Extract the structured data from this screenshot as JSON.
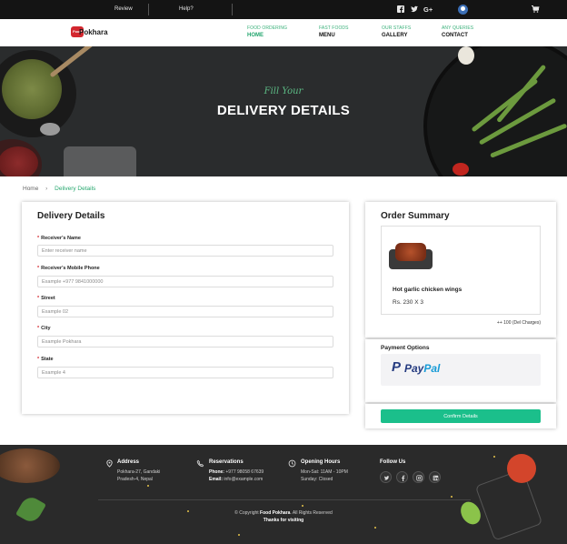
{
  "topbar": {
    "review": "Review",
    "help": "Help?",
    "icons": [
      "facebook-icon",
      "twitter-icon",
      "google-plus-icon",
      "user-icon",
      "cart-icon"
    ],
    "background": "#141414"
  },
  "brand": {
    "badge": "Food",
    "name": "Pokhara",
    "color": "#d3272f"
  },
  "nav": [
    {
      "top": "FOOD ORDERING",
      "bottom": "HOME",
      "active": true
    },
    {
      "top": "FAST FOODS",
      "bottom": "MENU",
      "active": false
    },
    {
      "top": "OUR STAFFS",
      "bottom": "GALLERY",
      "active": false
    },
    {
      "top": "ANY QUERIES",
      "bottom": "CONTACT",
      "active": false
    }
  ],
  "hero": {
    "kicker": "Fill Your",
    "title": "DELIVERY DETAILS"
  },
  "breadcrumb": {
    "home": "Home",
    "current": "Delivery Details"
  },
  "form": {
    "title": "Delivery Details",
    "fields": [
      {
        "label": "Receiver's Name",
        "placeholder": "Enter receiver name"
      },
      {
        "label": "Receiver's Mobile Phone",
        "placeholder": "Example +977 9841000000"
      },
      {
        "label": "Street",
        "placeholder": "Example 02"
      },
      {
        "label": "City",
        "placeholder": "Example Pokhara"
      },
      {
        "label": "State",
        "placeholder": "Example 4"
      }
    ]
  },
  "summary": {
    "title": "Order Summary",
    "item_name": "Hot garlic chicken wings",
    "item_price": "Rs. 230 X 3",
    "del_charges": "++ 100 (Del Charges)"
  },
  "payment": {
    "title": "Payment Options",
    "provider": "PayPal"
  },
  "confirm": {
    "label": "Confirm Details",
    "color": "#1bbf8b"
  },
  "footer": {
    "address_head": "Address",
    "address_1": "Pokhara-27, Gandaki",
    "address_2": "Pradesh-4, Nepal",
    "reservations_head": "Reservations",
    "phone_label": "Phone:",
    "phone": "+977 98058 67639",
    "email_label": "Email:",
    "email": "info@example.com",
    "hours_head": "Opening Hours",
    "hours_1": "Mon-Sat: 11AM - 10PM",
    "hours_2": "Sunday: Closed",
    "follow_head": "Follow Us",
    "social": [
      "twitter-icon",
      "facebook-icon",
      "instagram-icon",
      "linkedin-icon"
    ],
    "copyright_pre": "© Copyright",
    "copyright_brand": "Food Pokhara",
    "copyright_post": ". All Rights Reserved",
    "thanks": "Thanks for visiting"
  }
}
